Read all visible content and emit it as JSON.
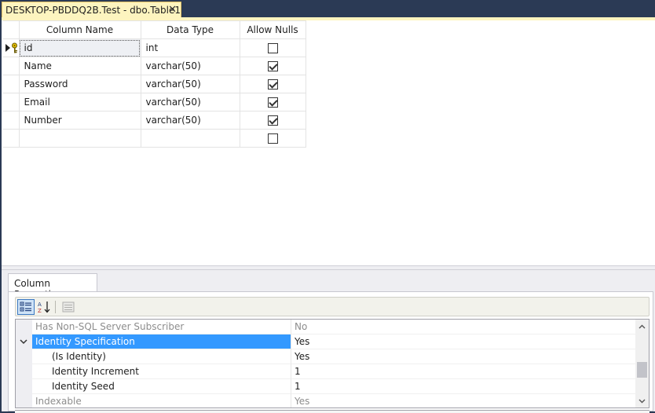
{
  "document_tab": {
    "title": "DESKTOP-PBDDQ2B.Test - dbo.Table1",
    "close_glyph": "✕"
  },
  "table_designer": {
    "headers": {
      "column_name": "Column Name",
      "data_type": "Data Type",
      "allow_nulls": "Allow Nulls"
    },
    "rows": [
      {
        "name": "id",
        "type": "int",
        "allow_nulls": false,
        "primary_key": true,
        "current": true
      },
      {
        "name": "Name",
        "type": "varchar(50)",
        "allow_nulls": true
      },
      {
        "name": "Password",
        "type": "varchar(50)",
        "allow_nulls": true
      },
      {
        "name": "Email",
        "type": "varchar(50)",
        "allow_nulls": true
      },
      {
        "name": "Number",
        "type": "varchar(50)",
        "allow_nulls": true
      },
      {
        "name": "",
        "type": "",
        "allow_nulls": false
      }
    ]
  },
  "column_properties": {
    "tab_label": "Column Properties",
    "toolbar": {
      "categorized_icon": "categorized-icon",
      "alphabetical_icon": "alphabetical-sort-icon",
      "property_pages_icon": "property-pages-icon"
    },
    "properties": [
      {
        "name": "Has Non-SQL Server Subscriber",
        "value": "No",
        "disabled": true
      },
      {
        "name": "Identity Specification",
        "value": "Yes",
        "expanded": true,
        "selected": true
      },
      {
        "name": "(Is Identity)",
        "value": "Yes",
        "child": true
      },
      {
        "name": "Identity Increment",
        "value": "1",
        "child": true
      },
      {
        "name": "Identity Seed",
        "value": "1",
        "child": true
      },
      {
        "name": "Indexable",
        "value": "Yes",
        "disabled": true
      }
    ]
  },
  "colors": {
    "tab_active": "#fdf4bf",
    "selection": "#3399ff",
    "chrome": "#2b3a55"
  }
}
